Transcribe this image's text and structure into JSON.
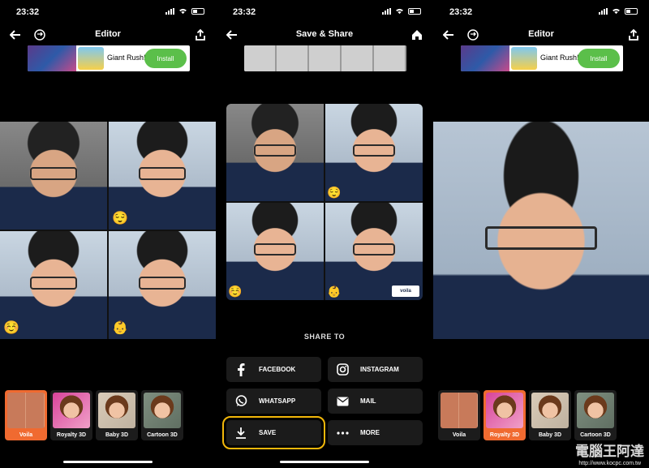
{
  "status": {
    "time": "23:32"
  },
  "panel1": {
    "title": "Editor"
  },
  "panel2": {
    "title": "Save & Share"
  },
  "panel3": {
    "title": "Editor"
  },
  "ad": {
    "text": "Giant Rush!",
    "install": "Install"
  },
  "share": {
    "title": "SHARE TO",
    "buttons": [
      {
        "label": "FACEBOOK",
        "icon": "facebook-icon"
      },
      {
        "label": "INSTAGRAM",
        "icon": "instagram-icon"
      },
      {
        "label": "WHATSAPP",
        "icon": "whatsapp-icon"
      },
      {
        "label": "MAIL",
        "icon": "mail-icon"
      },
      {
        "label": "SAVE",
        "icon": "download-icon"
      },
      {
        "label": "MORE",
        "icon": "more-icon"
      }
    ]
  },
  "voila_mark": "voila",
  "filters1": [
    {
      "label": "Voila",
      "active": true
    },
    {
      "label": "Royalty 3D",
      "active": false
    },
    {
      "label": "Baby 3D",
      "active": false
    },
    {
      "label": "Cartoon 3D",
      "active": false
    }
  ],
  "filters3": [
    {
      "label": "Voila",
      "active": false
    },
    {
      "label": "Royalty 3D",
      "active": true
    },
    {
      "label": "Baby 3D",
      "active": false
    },
    {
      "label": "Cartoon 3D",
      "active": false
    }
  ],
  "watermark": {
    "text": "電腦王阿達",
    "url": "http://www.kocpc.com.tw"
  },
  "colors": {
    "accent": "#f06a30",
    "highlight": "#f2b70a",
    "install": "#5bbf4a"
  }
}
